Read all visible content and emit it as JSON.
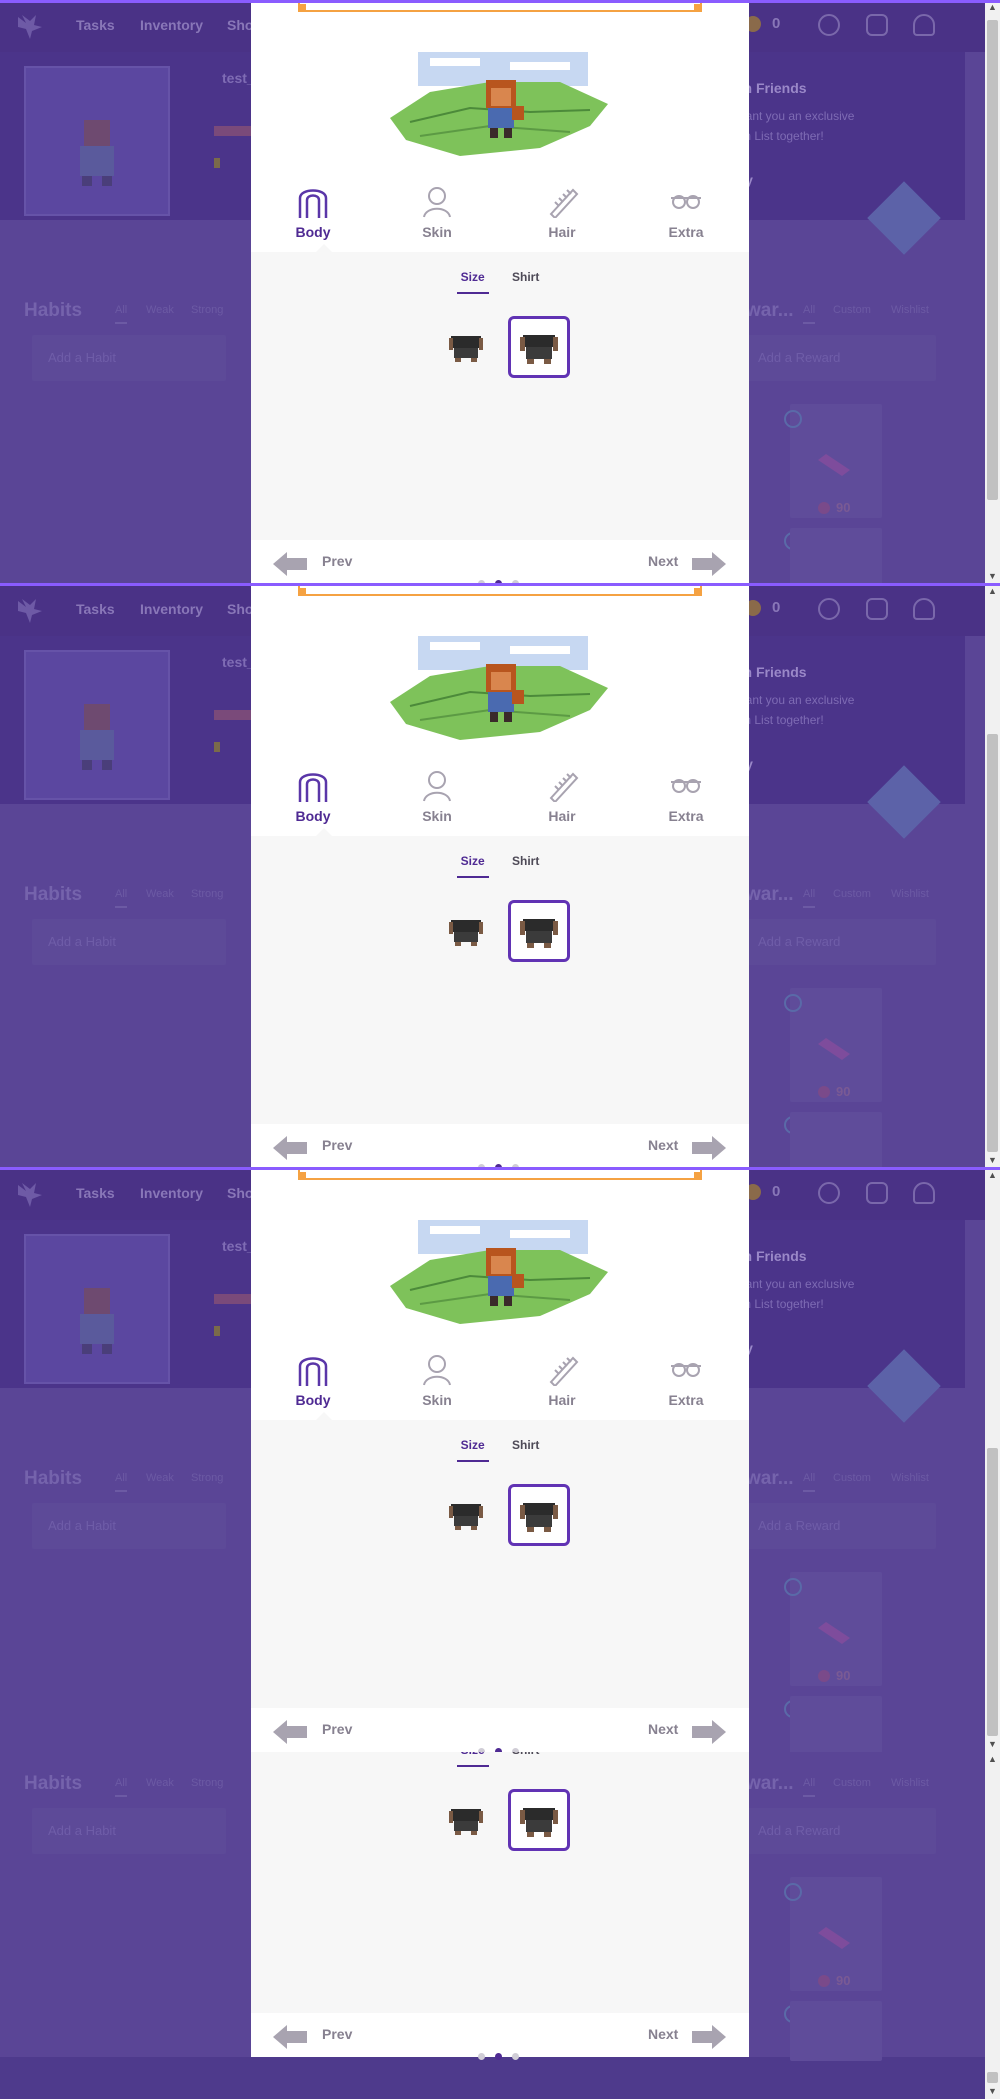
{
  "nav": {
    "items": [
      "Tasks",
      "Inventory",
      "Sho"
    ],
    "gold_value": "0"
  },
  "profile": {
    "username": "test_"
  },
  "party_banner": {
    "title": "ith Friends",
    "line1": "grant you an exclusive",
    "line2": "ain List together!",
    "link": "rty"
  },
  "habits": {
    "title": "Habits",
    "filters": [
      "All",
      "Weak",
      "Strong"
    ],
    "add_placeholder": "Add a Habit"
  },
  "rewards": {
    "title": "war...",
    "filters": [
      "All",
      "Custom",
      "Wishlist"
    ],
    "add_placeholder": "Add a Reward",
    "price": "90"
  },
  "customizer": {
    "categories": [
      {
        "label": "Body",
        "icon": "body-icon",
        "active": true
      },
      {
        "label": "Skin",
        "icon": "skin-icon",
        "active": false
      },
      {
        "label": "Hair",
        "icon": "hair-icon",
        "active": false
      },
      {
        "label": "Extra",
        "icon": "extra-icon",
        "active": false
      }
    ],
    "subtabs": [
      {
        "label": "Size",
        "active": true
      },
      {
        "label": "Shirt",
        "active": false
      }
    ],
    "options": [
      {
        "name": "slim-body",
        "selected": false
      },
      {
        "name": "broad-body",
        "selected": true
      }
    ],
    "prev_label": "Prev",
    "next_label": "Next",
    "page_dots": 3,
    "current_page": 2
  },
  "colors": {
    "accent": "#4f2a93",
    "selected_border": "#6133b4",
    "overlay": "#5a4596",
    "orange": "#f5a242"
  }
}
